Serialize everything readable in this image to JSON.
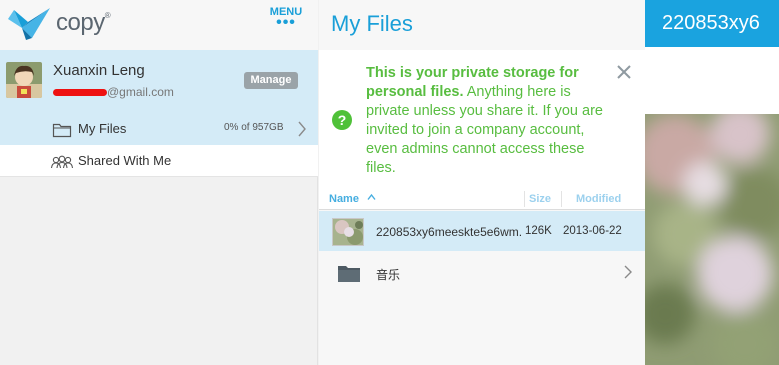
{
  "app": {
    "logo_text": "copy",
    "menu_label": "MENU",
    "menu_dots": "•••",
    "logo_icon": "origami-bird-icon",
    "accent_color": "#199fd8"
  },
  "user": {
    "name": "Xuanxin Leng",
    "email_suffix": "@gmail.com",
    "manage_label": "Manage"
  },
  "sidebar": {
    "items": [
      {
        "label": "My Files",
        "usage": "0% of 957GB",
        "icon": "folder-icon",
        "selected": true
      },
      {
        "label": "Shared With Me",
        "icon": "people-icon",
        "selected": false
      }
    ]
  },
  "main": {
    "title": "My Files",
    "notice": {
      "bold": "This is your private storage for personal files.",
      "body": " Anything here is private unless you share it. If you are invited to join a company account, even admins cannot access these files.",
      "icon": "question-circle-icon",
      "close_icon": "close-icon"
    },
    "columns": {
      "name": "Name",
      "size": "Size",
      "modified": "Modified"
    },
    "files": [
      {
        "name": "220853xy6meeskte5e6wm.",
        "size": "126K",
        "modified": "2013-06-22",
        "type": "image"
      },
      {
        "name": "音乐",
        "type": "folder"
      }
    ]
  },
  "preview": {
    "title": "220853xy6"
  }
}
